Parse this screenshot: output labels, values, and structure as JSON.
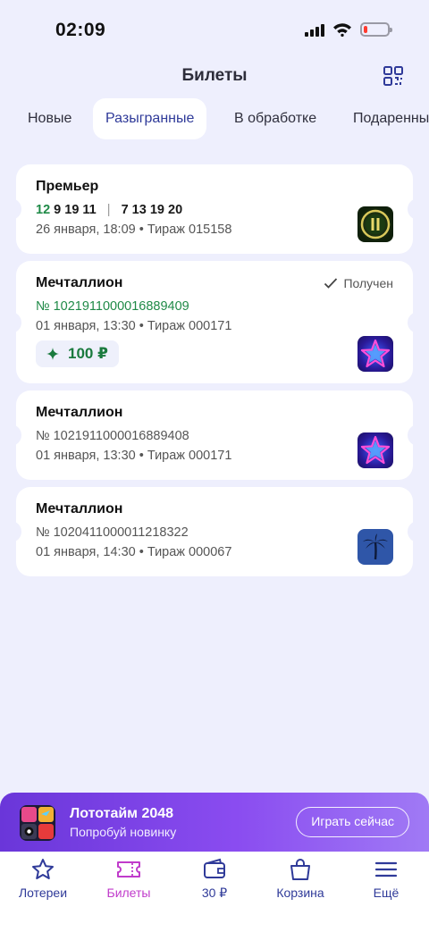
{
  "status_bar": {
    "time": "02:09",
    "battery_level": 0.15
  },
  "header": {
    "title": "Билеты",
    "qr_icon": "qr-code-icon"
  },
  "tabs": [
    {
      "label": "Новые",
      "active": false
    },
    {
      "label": "Разыгранные",
      "active": true
    },
    {
      "label": "В обработке",
      "active": false
    },
    {
      "label": "Подаренные",
      "active": false
    }
  ],
  "tickets": [
    {
      "title": "Премьер",
      "numbers_highlight": "12",
      "numbers_rest": "9 19 11",
      "numbers_separator": "|",
      "numbers_second": "7  13 19 20",
      "details": "26 января, 18:09 • Тираж 015158",
      "icon": "premier-lottery-icon"
    },
    {
      "title": "Мечталлион",
      "status": "Получен",
      "number": "№ 1021911000016889409",
      "details": "01 января, 13:30 • Тираж 000171",
      "prize": "100 ₽",
      "icon": "star-lottery-icon"
    },
    {
      "title": "Мечталлион",
      "number": "№ 1021911000016889408",
      "details": "01 января, 13:30 • Тираж 000171",
      "icon": "star-lottery-icon"
    },
    {
      "title": "Мечталлион",
      "number": "№ 1020411000011218322",
      "details": "01 января, 14:30 • Тираж 000067",
      "icon": "palm-lottery-icon"
    }
  ],
  "promo": {
    "title": "Лототайм 2048",
    "subtitle": "Попробуй новинку",
    "button": "Играть сейчас",
    "icon": "lototime-game-icon"
  },
  "nav": [
    {
      "label": "Лотереи",
      "icon": "star-icon",
      "active": false
    },
    {
      "label": "Билеты",
      "icon": "ticket-icon",
      "active": true
    },
    {
      "label": "30 ₽",
      "icon": "wallet-icon",
      "active": false
    },
    {
      "label": "Корзина",
      "icon": "shopping-bag-icon",
      "active": false
    },
    {
      "label": "Ещё",
      "icon": "menu-icon",
      "active": false
    }
  ],
  "colors": {
    "accent": "#2f3a99",
    "active_nav": "#c03bcb",
    "win_green": "#1f8a47",
    "background": "#eeeffd"
  }
}
